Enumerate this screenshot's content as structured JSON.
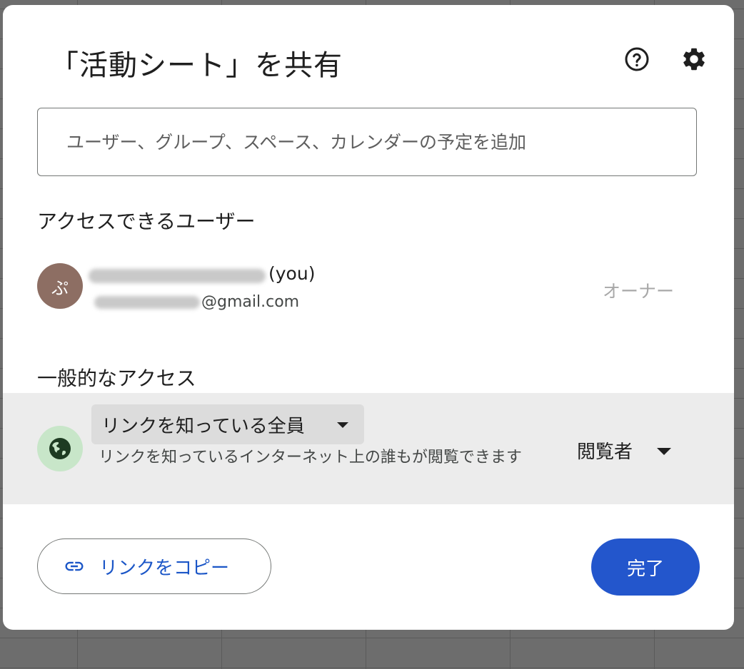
{
  "dialog": {
    "title": "「活動シート」を共有",
    "icons": {
      "help": "help-circle-icon",
      "settings": "gear-icon"
    }
  },
  "add_people": {
    "placeholder": "ユーザー、グループ、スペース、カレンダーの予定を追加"
  },
  "people_with_access": {
    "heading": "アクセスできるユーザー",
    "users": [
      {
        "avatar_initial": "ぷ",
        "avatar_color": "#8d6e63",
        "name_suffix": "(you)",
        "email_suffix": "@gmail.com",
        "role": "オーナー"
      }
    ]
  },
  "general_access": {
    "heading": "一般的なアクセス",
    "scope_label": "リンクを知っている全員",
    "description": "リンクを知っているインターネット上の誰もが閲覧できます",
    "role_label": "閲覧者",
    "icon": "globe-icon"
  },
  "actions": {
    "copy_link_label": "リンクをコピー",
    "done_label": "完了"
  },
  "colors": {
    "primary": "#2356cc",
    "link_text": "#1b56c7",
    "access_band": "#ececec",
    "globe_bg": "#c8e6c9"
  }
}
